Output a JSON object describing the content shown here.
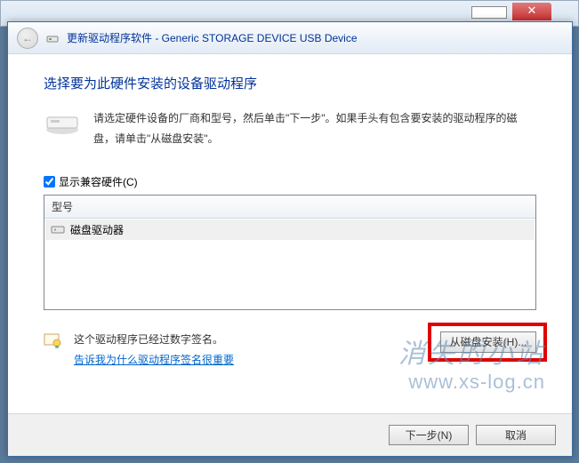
{
  "bgWindow": {
    "closeGlyph": "✕"
  },
  "titlebar": {
    "backGlyph": "←",
    "title": "更新驱动程序软件 - Generic STORAGE DEVICE USB Device"
  },
  "heading": "选择要为此硬件安装的设备驱动程序",
  "instruction": "请选定硬件设备的厂商和型号，然后单击\"下一步\"。如果手头有包含要安装的驱动程序的磁盘，请单击\"从磁盘安装\"。",
  "compatCheckbox": {
    "label": "显示兼容硬件(C)",
    "checked": true
  },
  "list": {
    "header": "型号",
    "items": [
      {
        "label": "磁盘驱动器"
      }
    ]
  },
  "signature": {
    "text": "这个驱动程序已经过数字签名。",
    "link": "告诉我为什么驱动程序签名很重要"
  },
  "buttons": {
    "haveDisk": "从磁盘安装(H)...",
    "next": "下一步(N)",
    "cancel": "取消"
  },
  "watermark": {
    "line1": "消失的小站",
    "line2": "www.xs-log.cn"
  }
}
